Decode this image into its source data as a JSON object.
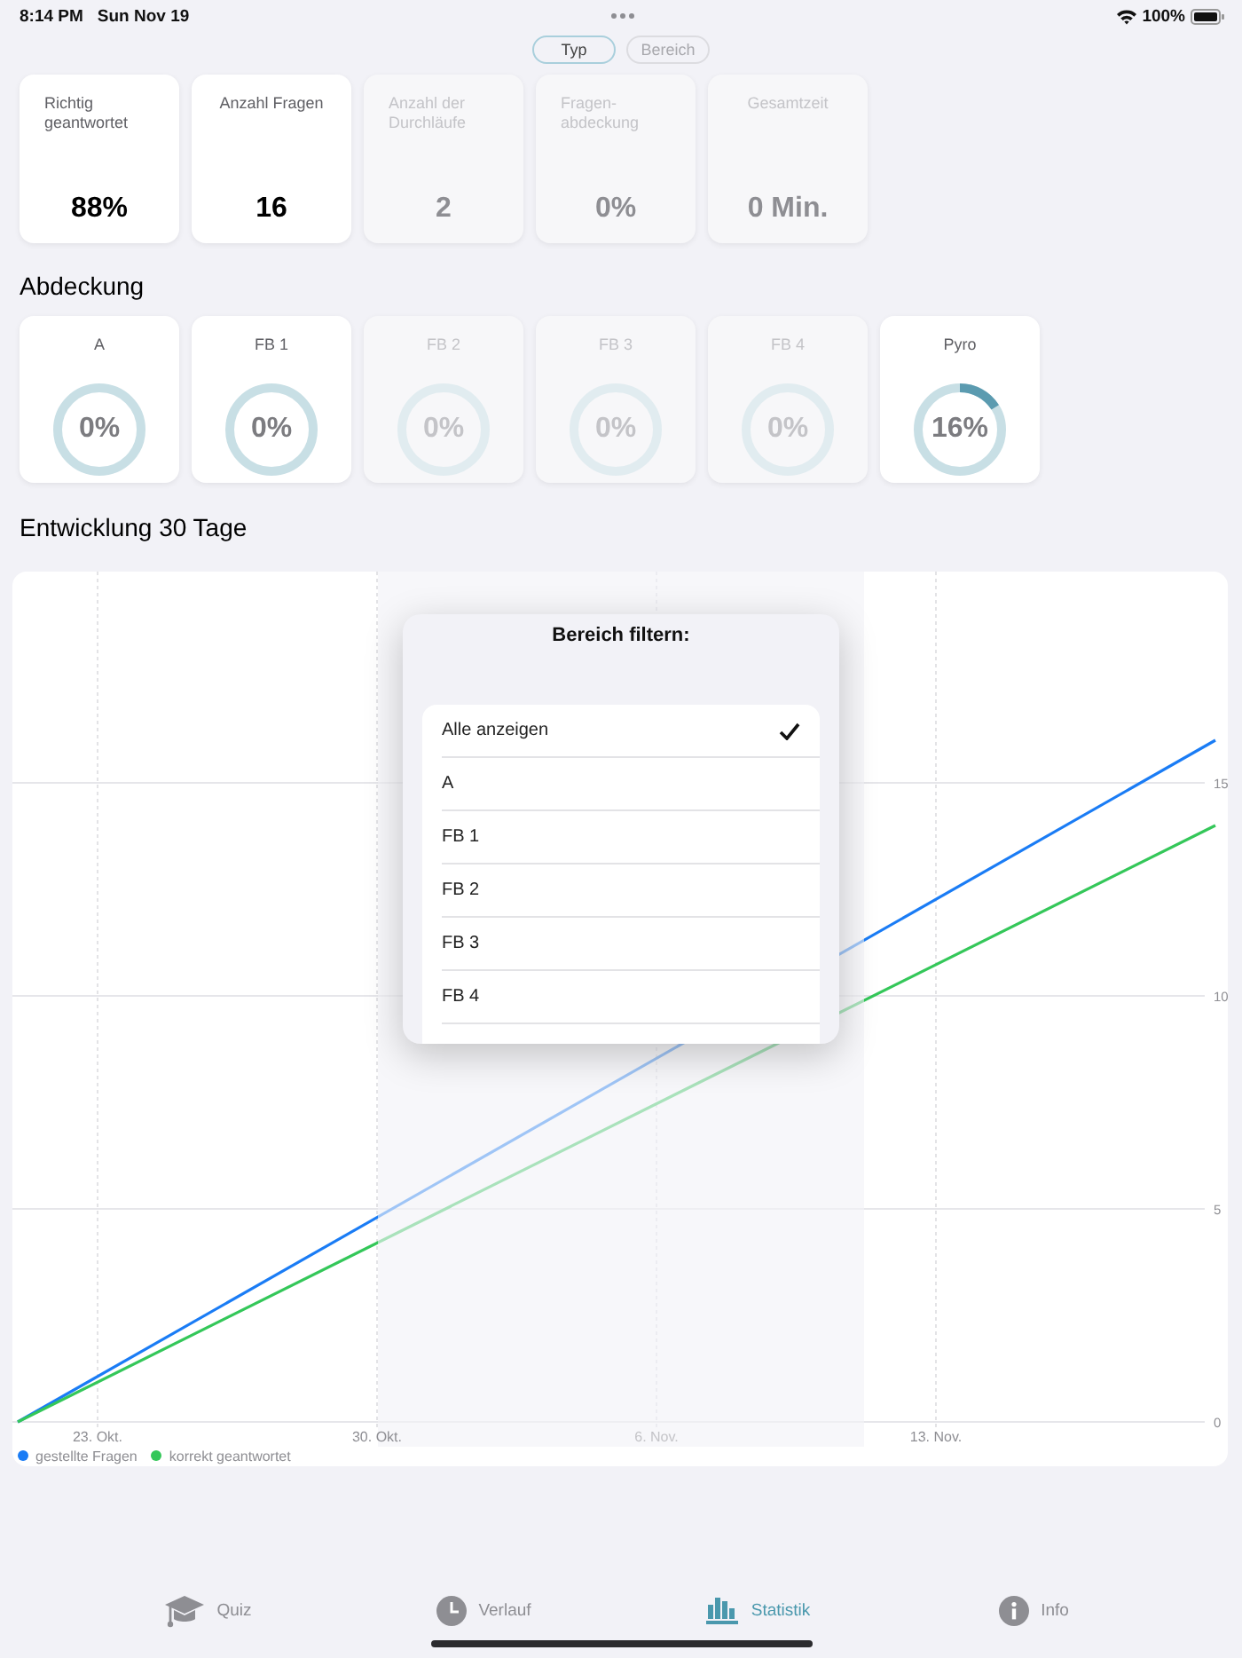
{
  "status_bar": {
    "time": "8:14 PM",
    "date": "Sun Nov 19",
    "battery": "100%"
  },
  "segments": [
    {
      "label": "Typ",
      "selected": true
    },
    {
      "label": "Bereich",
      "selected": false
    }
  ],
  "stat_cards": [
    {
      "label": "Richtig geantwortet",
      "value": "88%",
      "dimmed": false
    },
    {
      "label": "Anzahl Fragen",
      "value": "16",
      "dimmed": false
    },
    {
      "label": "Anzahl der Durchläufe",
      "value": "2",
      "dimmed": true
    },
    {
      "label": "Fragen-abdeckung",
      "value": "0%",
      "dimmed": true
    },
    {
      "label": "Gesamtzeit",
      "value": "0 Min.",
      "dimmed": true
    }
  ],
  "coverage_heading": "Abdeckung",
  "coverage_cards": [
    {
      "label": "A",
      "value": "0%",
      "level": 0,
      "dimmed": false
    },
    {
      "label": "FB 1",
      "value": "0%",
      "level": 0,
      "dimmed": false
    },
    {
      "label": "FB 2",
      "value": "0%",
      "level": 0,
      "dimmed": true
    },
    {
      "label": "FB 3",
      "value": "0%",
      "level": 0,
      "dimmed": true
    },
    {
      "label": "FB 4",
      "value": "0%",
      "level": 0,
      "dimmed": true
    },
    {
      "label": "Pyro",
      "value": "16%",
      "level": 0.16,
      "dimmed": false
    }
  ],
  "chart": {
    "heading": "Entwicklung 30 Tage",
    "chart_data": {
      "type": "line",
      "grid": true,
      "categories": [
        null,
        null,
        "23. Okt.",
        null,
        null,
        null,
        null,
        null,
        null,
        "30. Okt.",
        null,
        null,
        null,
        null,
        null,
        null,
        "6. Nov.",
        null,
        null,
        null,
        null,
        null,
        null,
        "13. Nov.",
        null,
        null,
        null,
        null,
        null,
        null,
        null
      ],
      "ylim": [
        0,
        20
      ],
      "yticks": [
        0,
        5,
        10,
        15
      ],
      "series": [
        {
          "name": "gestellte Fragen",
          "color": "#1a7cf5",
          "values": [
            0,
            null,
            null,
            null,
            null,
            null,
            null,
            null,
            null,
            null,
            null,
            null,
            null,
            null,
            null,
            null,
            null,
            null,
            null,
            null,
            null,
            null,
            null,
            null,
            null,
            null,
            null,
            null,
            null,
            null,
            16
          ]
        },
        {
          "name": "korrekt geantwortet",
          "color": "#34c759",
          "values": [
            0,
            null,
            null,
            null,
            null,
            null,
            null,
            null,
            null,
            null,
            null,
            null,
            null,
            null,
            null,
            null,
            null,
            null,
            null,
            null,
            null,
            null,
            null,
            null,
            null,
            null,
            null,
            null,
            null,
            null,
            14
          ]
        }
      ]
    }
  },
  "popover": {
    "title": "Bereich filtern:",
    "items": [
      {
        "label": "Alle anzeigen",
        "selected": true
      },
      {
        "label": "A",
        "selected": false
      },
      {
        "label": "FB 1",
        "selected": false
      },
      {
        "label": "FB 2",
        "selected": false
      },
      {
        "label": "FB 3",
        "selected": false
      },
      {
        "label": "FB 4",
        "selected": false
      }
    ]
  },
  "tabs": [
    {
      "label": "Quiz",
      "selected": false
    },
    {
      "label": "Verlauf",
      "selected": false
    },
    {
      "label": "Statistik",
      "selected": true
    },
    {
      "label": "Info",
      "selected": false
    }
  ]
}
